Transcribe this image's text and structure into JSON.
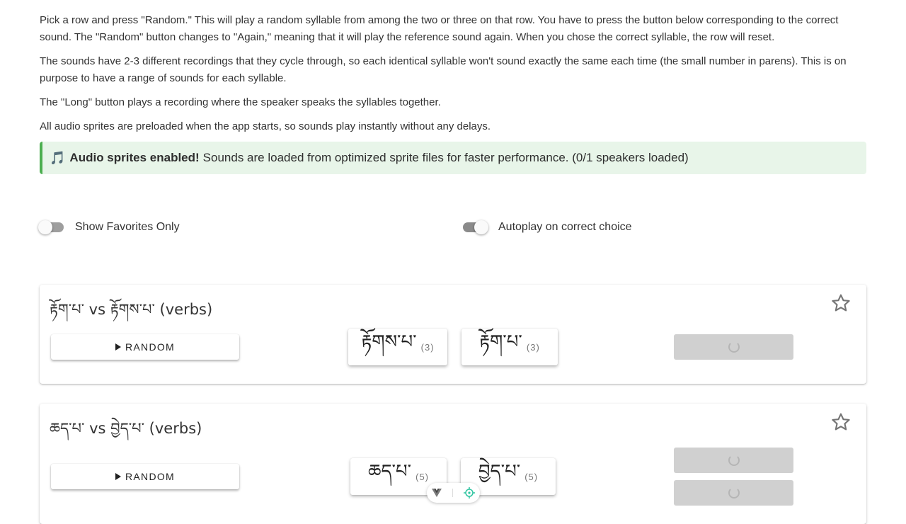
{
  "intro": {
    "p1": "Pick a row and press \"Random.\" This will play a random syllable from among the two or three on that row. You have to press the button below corresponding to the correct sound. The \"Random\" button changes to \"Again,\" meaning that it will play the reference sound again. When you chose the correct syllable, the row will reset.",
    "p2": "The sounds have 2-3 different recordings that they cycle through, so each identical syllable won't sound exactly the same each time (the small number in parens). This is on purpose to have a range of sounds for each syllable.",
    "p3": "The \"Long\" button plays a recording where the speaker speaks the syllables together.",
    "p4": "All audio sprites are preloaded when the app starts, so sounds play instantly without any delays."
  },
  "alert": {
    "icon": "🎵",
    "bold": "Audio sprites enabled!",
    "text": "Sounds are loaded from optimized sprite files for faster performance. (0/1 speakers loaded)",
    "accent_color": "#4caf50",
    "bg_color": "#e8f5e9"
  },
  "toggles": {
    "favorites": {
      "label": "Show Favorites Only",
      "on": false
    },
    "autoplay": {
      "label": "Autoplay on correct choice",
      "on": true
    }
  },
  "rows": [
    {
      "title": "རྟོག་པ་ vs རྟོགས་པ་ (verbs)",
      "random_label": "RANDOM",
      "syllables": [
        {
          "text": "རྟོགས་པ་",
          "count": "(3)"
        },
        {
          "text": "རྟོག་པ་",
          "count": "(3)"
        }
      ],
      "long_buttons": 1
    },
    {
      "title": "ཆད་པ་ vs བྱེད་པ་ (verbs)",
      "random_label": "RANDOM",
      "syllables": [
        {
          "text": "ཆད་པ་",
          "count": "(5)"
        },
        {
          "text": "བྱེད་པ་",
          "count": "(5)"
        }
      ],
      "long_buttons": 2
    }
  ]
}
